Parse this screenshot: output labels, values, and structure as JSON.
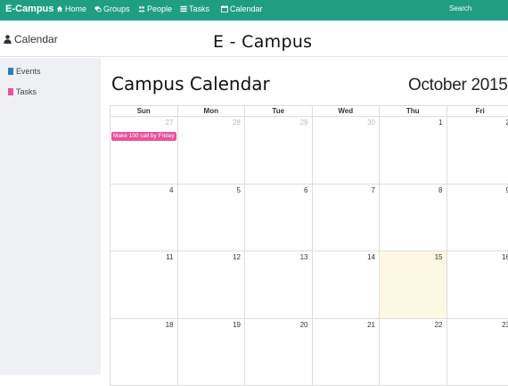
{
  "navbar": {
    "brand": "E-Campus",
    "items": [
      {
        "label": "Home",
        "icon": "home-icon"
      },
      {
        "label": "Groups",
        "icon": "groups-icon"
      },
      {
        "label": "People",
        "icon": "people-icon"
      },
      {
        "label": "Tasks",
        "icon": "tasks-icon"
      },
      {
        "label": "Calendar",
        "icon": "calendar-icon"
      }
    ],
    "search_label": "Search",
    "color": "#1f9e82"
  },
  "header": {
    "section_title": "Calendar",
    "section_icon": "user-icon",
    "app_title": "E - Campus"
  },
  "sidebar": {
    "legend": [
      {
        "label": "Events",
        "color": "#2a7fc0"
      },
      {
        "label": "Tasks",
        "color": "#e8529b"
      }
    ]
  },
  "calendar": {
    "title": "Campus Calendar",
    "month": "October 2015",
    "days_of_week": [
      "Sun",
      "Mon",
      "Tue",
      "Wed",
      "Thu",
      "Fri"
    ],
    "weeks": [
      [
        {
          "n": "27",
          "other": true
        },
        {
          "n": "28",
          "other": true
        },
        {
          "n": "29",
          "other": true
        },
        {
          "n": "30",
          "other": true
        },
        {
          "n": "1"
        },
        {
          "n": "2"
        }
      ],
      [
        {
          "n": "4"
        },
        {
          "n": "5"
        },
        {
          "n": "6"
        },
        {
          "n": "7"
        },
        {
          "n": "8"
        },
        {
          "n": "9"
        }
      ],
      [
        {
          "n": "11"
        },
        {
          "n": "12"
        },
        {
          "n": "13"
        },
        {
          "n": "14"
        },
        {
          "n": "15",
          "today": true
        },
        {
          "n": "16"
        }
      ],
      [
        {
          "n": "18"
        },
        {
          "n": "19"
        },
        {
          "n": "20"
        },
        {
          "n": "21"
        },
        {
          "n": "22"
        },
        {
          "n": "23"
        }
      ]
    ],
    "event": {
      "label": "Make 100 call by Friday",
      "color": "#e8529b"
    },
    "today_color": "#fcf8e3"
  }
}
